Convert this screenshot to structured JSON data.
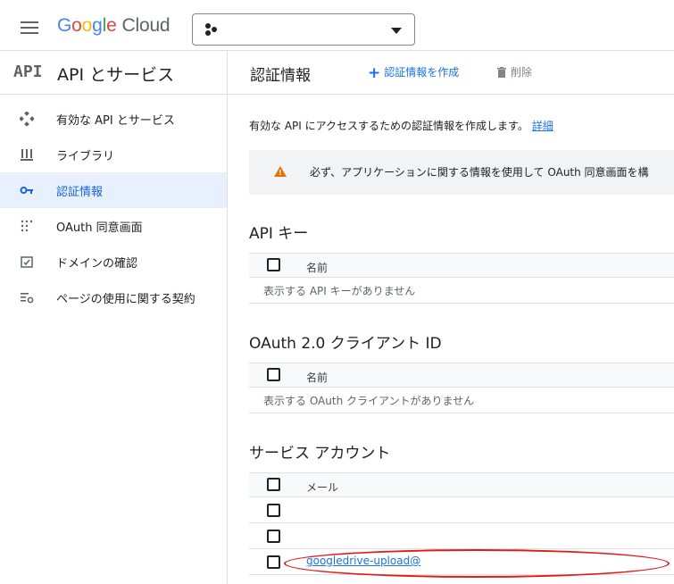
{
  "header": {
    "logo_letters": [
      "G",
      "o",
      "o",
      "g",
      "l",
      "e"
    ],
    "logo_product": "Cloud",
    "project_value": ""
  },
  "sidebar": {
    "api_logo": "API",
    "title": "API とサービス",
    "items": [
      {
        "label": "有効な API とサービス",
        "icon": "enabled-apis-icon",
        "active": false
      },
      {
        "label": "ライブラリ",
        "icon": "library-icon",
        "active": false
      },
      {
        "label": "認証情報",
        "icon": "key-icon",
        "active": true
      },
      {
        "label": "OAuth 同意画面",
        "icon": "oauth-consent-icon",
        "active": false
      },
      {
        "label": "ドメインの確認",
        "icon": "domain-verification-icon",
        "active": false
      },
      {
        "label": "ページの使用に関する契約",
        "icon": "page-usage-agreement-icon",
        "active": false
      }
    ]
  },
  "main": {
    "title": "認証情報",
    "create_label": "認証情報を作成",
    "delete_label": "削除",
    "intro_text": "有効な API にアクセスするための認証情報を作成します。",
    "intro_link": "詳細",
    "warning_text": "必ず、アプリケーションに関する情報を使用して OAuth 同意画面を構",
    "api_keys": {
      "title": "API キー",
      "column": "名前",
      "empty": "表示する API キーがありません"
    },
    "oauth_clients": {
      "title": "OAuth 2.0 クライアント ID",
      "column": "名前",
      "empty": "表示する OAuth クライアントがありません"
    },
    "service_accounts": {
      "title": "サービス アカウント",
      "column": "メール",
      "rows": [
        "",
        "",
        "googledrive-upload@"
      ]
    }
  },
  "colors": {
    "accent": "#1a73e8",
    "active_bg": "#e8f0fe",
    "warning": "#e37400",
    "highlight": "#e01b1b"
  }
}
